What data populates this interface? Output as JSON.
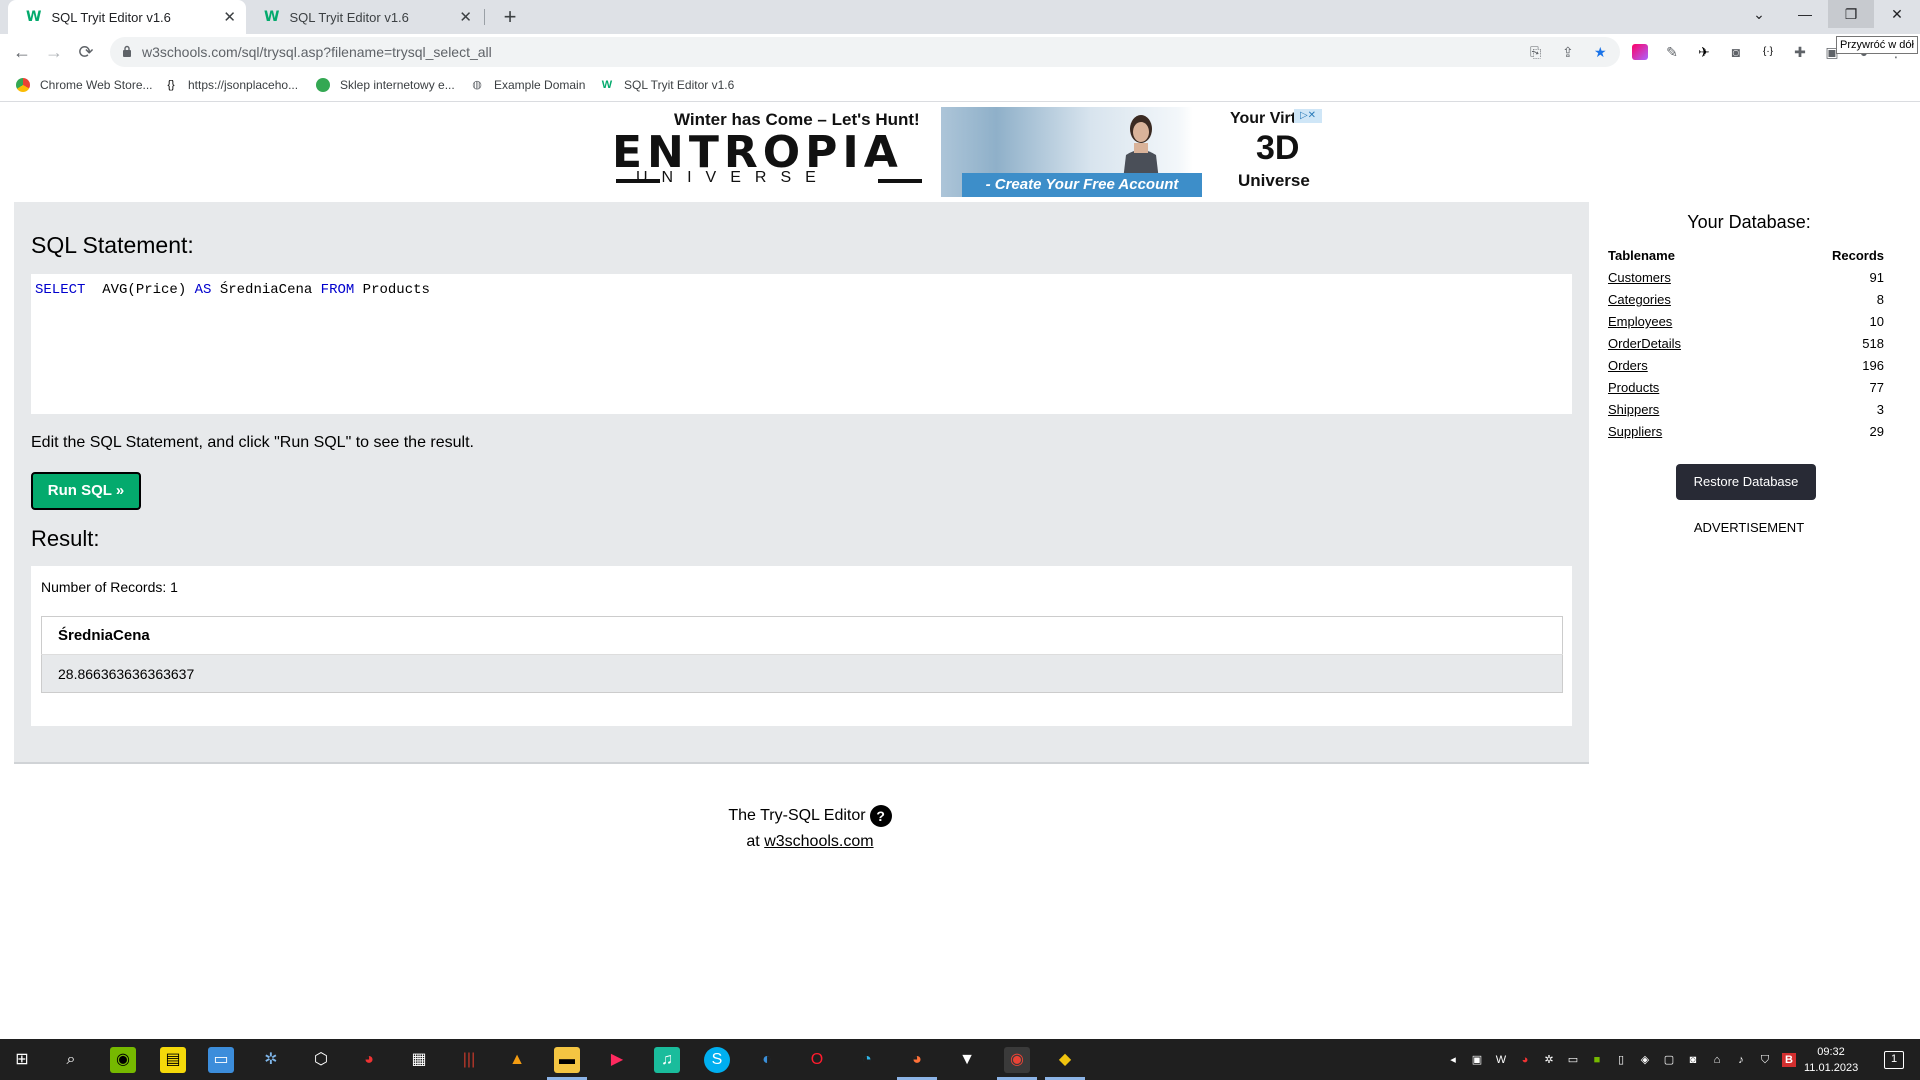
{
  "browser": {
    "tabs": [
      {
        "title": "SQL Tryit Editor v1.6",
        "active": true
      },
      {
        "title": "SQL Tryit Editor v1.6",
        "active": false
      }
    ],
    "new_tab": "+",
    "address": "w3schools.com/sql/trysql.asp?filename=trysql_select_all",
    "tooltip": "Przywróć w dół",
    "bookmarks": [
      {
        "label": "Chrome Web Store..."
      },
      {
        "label": "https://jsonplaceho..."
      },
      {
        "label": "Sklep internetowy e..."
      },
      {
        "label": "Example Domain"
      },
      {
        "label": "SQL Tryit Editor v1.6"
      }
    ]
  },
  "ad": {
    "tagline": "Winter has Come – Let's Hunt!",
    "brand": "ENTROPIA",
    "sub": "UNIVERSE",
    "cta": "- Create Your Free Account Today -",
    "right_line1": "Your Virtual",
    "right_line2": "3D",
    "right_line3": "Universe"
  },
  "editor": {
    "heading": "SQL Statement:",
    "sql": {
      "kw_select": "SELECT",
      "part1": "  AVG(Price) ",
      "kw_as": "AS",
      "part2": " ŚredniaCena ",
      "kw_from": "FROM",
      "part3": " Products"
    },
    "instruction": "Edit the SQL Statement, and click \"Run SQL\" to see the result.",
    "run_button": "Run SQL »",
    "result_heading": "Result:",
    "record_count": "Number of Records: 1",
    "result_columns": [
      "ŚredniaCena"
    ],
    "result_rows": [
      [
        "28.866363636363637"
      ]
    ]
  },
  "database": {
    "title": "Your Database:",
    "col_name": "Tablename",
    "col_records": "Records",
    "tables": [
      {
        "name": "Customers",
        "records": "91"
      },
      {
        "name": "Categories",
        "records": "8"
      },
      {
        "name": "Employees",
        "records": "10"
      },
      {
        "name": "OrderDetails",
        "records": "518"
      },
      {
        "name": "Orders",
        "records": "196"
      },
      {
        "name": "Products",
        "records": "77"
      },
      {
        "name": "Shippers",
        "records": "3"
      },
      {
        "name": "Suppliers",
        "records": "29"
      }
    ],
    "restore_button": "Restore Database",
    "advertisement": "ADVERTISEMENT"
  },
  "footer": {
    "line1": "The Try-SQL Editor",
    "help_icon": "?",
    "prefix": "at ",
    "link": "w3schools.com"
  },
  "taskbar": {
    "time": "09:32",
    "date": "11.01.2023",
    "notification_count": "1"
  },
  "colors": {
    "run_button": "#04aa6d",
    "sql_keyword": "#0000cd",
    "panel_bg": "#e7e9eb",
    "restore_button": "#282a35"
  }
}
